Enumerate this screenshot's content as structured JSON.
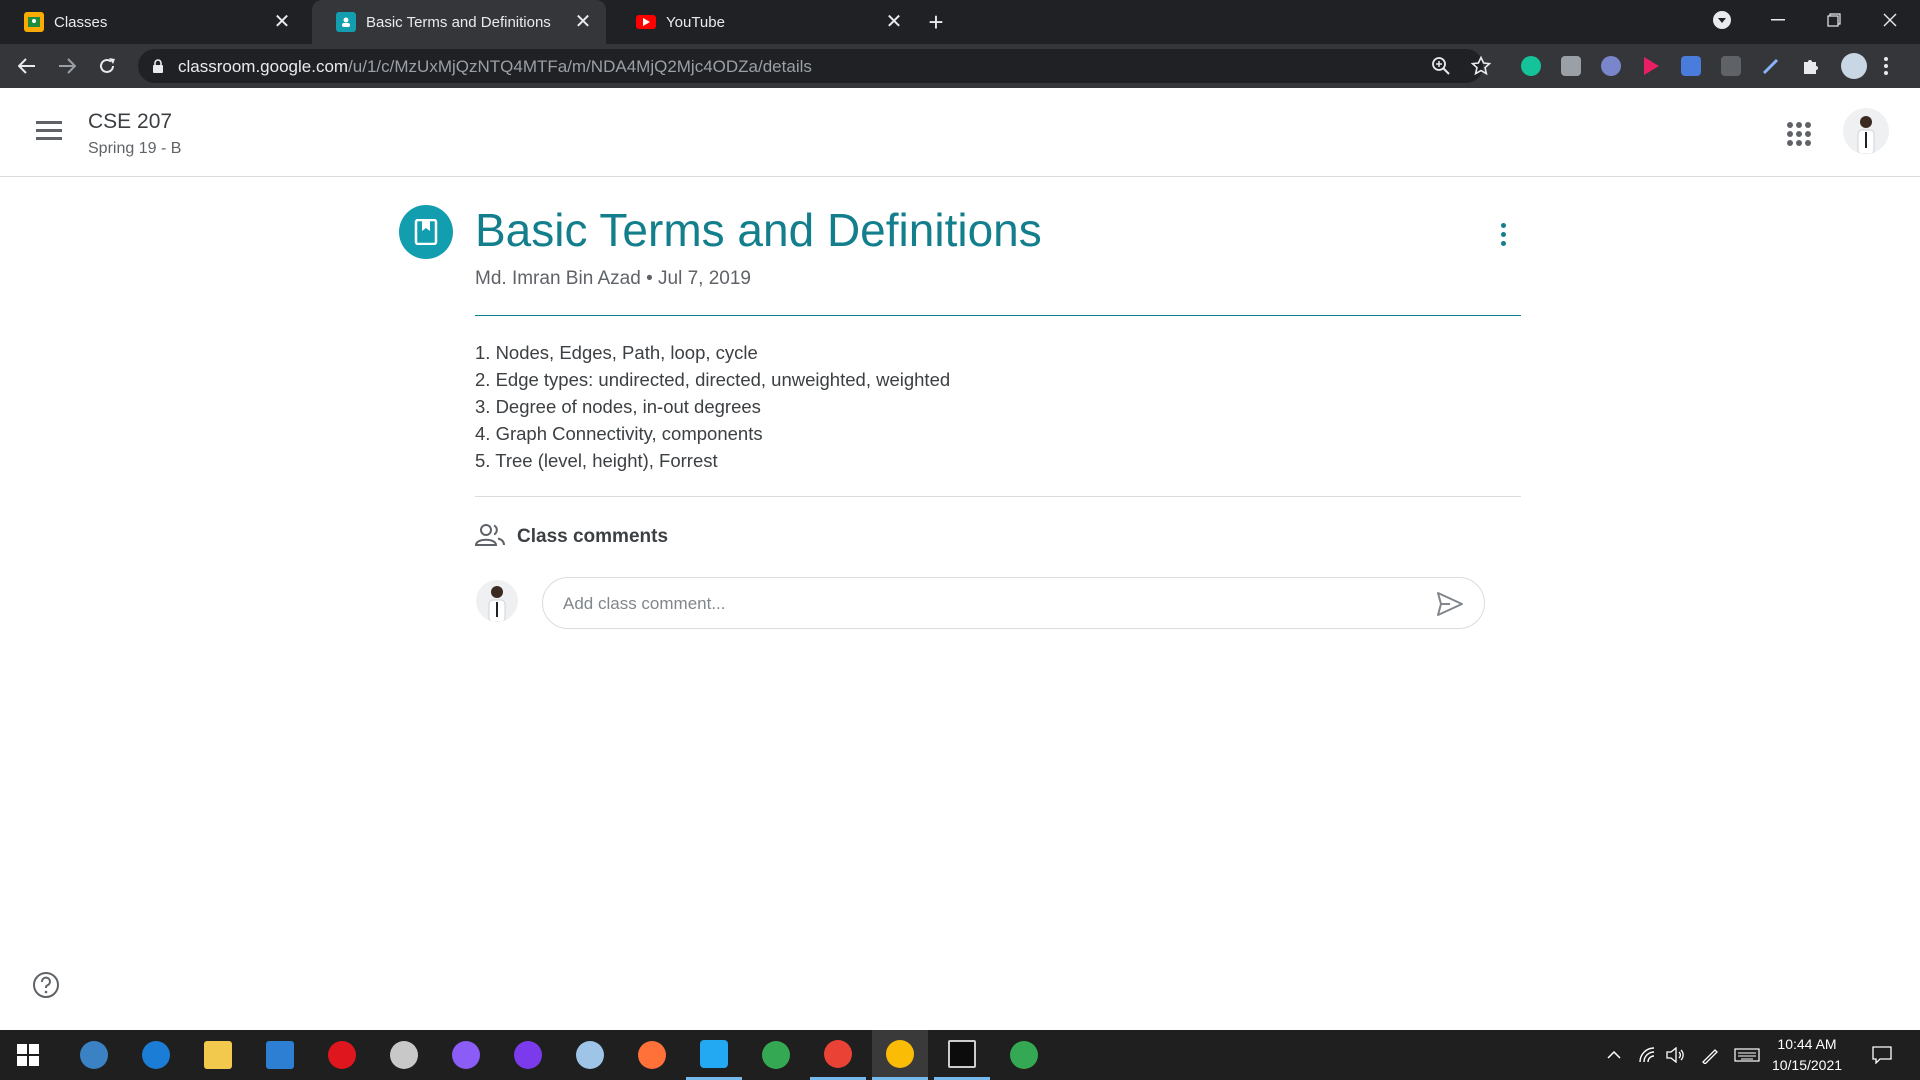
{
  "browser": {
    "tabs": [
      {
        "title": "Classes",
        "favicon": "classroom-yellow-icon",
        "color": "#f9ab00"
      },
      {
        "title": "Basic Terms and Definitions",
        "favicon": "classroom-teal-icon",
        "color": "#129eaf"
      },
      {
        "title": "YouTube",
        "favicon": "youtube-icon",
        "color": "#ff0000"
      }
    ],
    "url_host": "classroom.google.com",
    "url_path": "/u/1/c/MzUxMjQzNTQ4MTFa/m/NDA4MjQ2Mjc4ODZa/details"
  },
  "header": {
    "course_title": "CSE 207",
    "course_section": "Spring 19 - B"
  },
  "material": {
    "title": "Basic Terms and Definitions",
    "meta": "Md. Imran Bin Azad • Jul 7, 2019",
    "description": [
      "1. Nodes, Edges, Path, loop, cycle",
      "2. Edge types: undirected, directed, unweighted, weighted",
      "3. Degree of nodes, in-out degrees",
      "4. Graph Connectivity, components",
      "5. Tree (level, height), Forrest"
    ]
  },
  "comments": {
    "heading": "Class comments",
    "placeholder": "Add class comment..."
  },
  "taskbar": {
    "time": "10:44 AM",
    "date": "10/15/2021"
  },
  "colors": {
    "accent": "#137e8c",
    "icon_bg": "#129eaf"
  }
}
